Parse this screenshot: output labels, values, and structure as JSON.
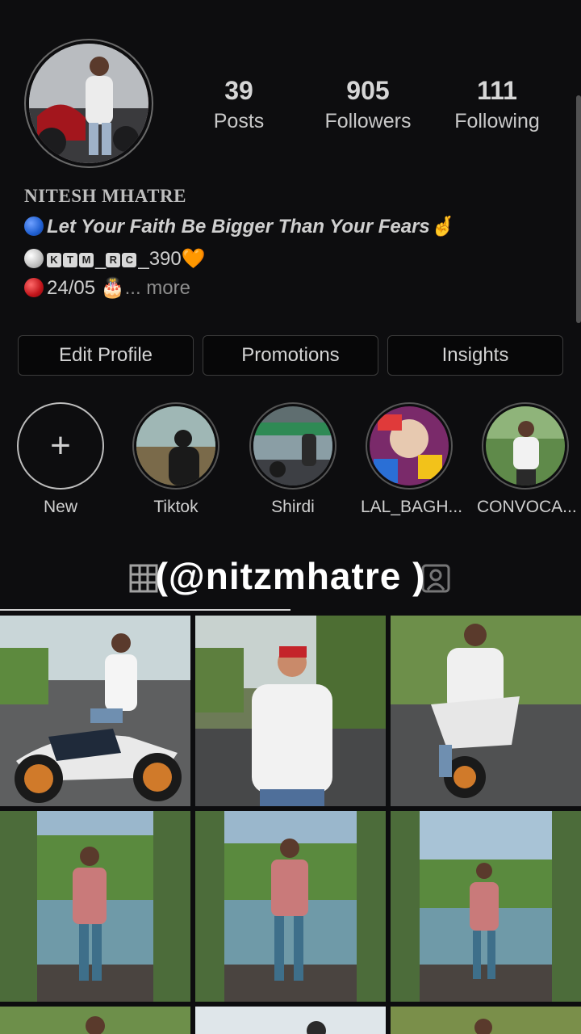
{
  "profile": {
    "stats": [
      {
        "value": "39",
        "label": "Posts"
      },
      {
        "value": "905",
        "label": "Followers"
      },
      {
        "value": "111",
        "label": "Following"
      }
    ],
    "name": "NITESH MHATRE",
    "bio": {
      "line1": "Let Your Faith Be Bigger Than Your Fears",
      "line1_emoji": "🤞",
      "line2_letters": [
        "K",
        "T",
        "M"
      ],
      "line2_mid": "_",
      "line2_letters2": [
        "R",
        "C"
      ],
      "line2_end": "_390",
      "line2_emoji": "🧡",
      "line3": "24/05",
      "line3_emoji": "🎂",
      "more": "... more"
    }
  },
  "buttons": {
    "edit_profile": "Edit Profile",
    "promotions": "Promotions",
    "insights": "Insights"
  },
  "highlights": [
    {
      "label": "New",
      "icon": "plus-icon"
    },
    {
      "label": "Tiktok"
    },
    {
      "label": "Shirdi"
    },
    {
      "label": "LAL_BAGH..."
    },
    {
      "label": "CONVOCA..."
    }
  ],
  "overlay": {
    "handle": "(@nitzmhatre )"
  },
  "icons": {
    "grid_tab": "grid-icon",
    "tagged_tab": "tagged-icon"
  },
  "colors": {
    "background": "#0d0d0f",
    "text": "#cfcfcf",
    "dot_blue": "#1f5fd1",
    "dot_white": "#d0d0d0",
    "dot_red": "#c0141a"
  }
}
